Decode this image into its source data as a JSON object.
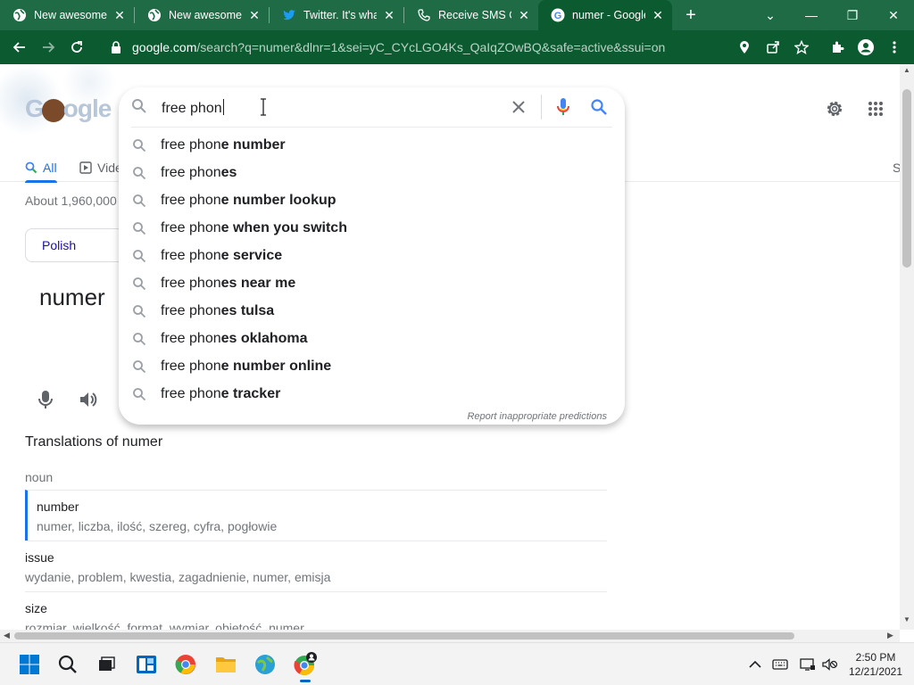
{
  "browser": {
    "tabs": [
      {
        "title": "New awesome t",
        "icon": "globe-icon",
        "active": false
      },
      {
        "title": "New awesome t",
        "icon": "globe-icon",
        "active": false
      },
      {
        "title": "Twitter. It's what",
        "icon": "twitter-icon",
        "active": false
      },
      {
        "title": "Receive SMS Or",
        "icon": "phone-icon",
        "active": false
      },
      {
        "title": "numer - Google",
        "icon": "google-icon",
        "active": true
      }
    ],
    "url_host": "google.com",
    "url_path": "/search?q=numer&dlnr=1&sei=yC_CYcLGO4Ks_QaIqZOwBQ&safe=active&ssui=on",
    "colors": {
      "chrome_dark": "#0b5a30",
      "tabstrip": "#1e6b45"
    }
  },
  "search": {
    "query": "free phon",
    "suggestions": [
      {
        "prefix": "free phon",
        "completion": "e number"
      },
      {
        "prefix": "free phon",
        "completion": "es"
      },
      {
        "prefix": "free phon",
        "completion": "e number lookup"
      },
      {
        "prefix": "free phon",
        "completion": "e when you switch"
      },
      {
        "prefix": "free phon",
        "completion": "e service"
      },
      {
        "prefix": "free phon",
        "completion": "es near me"
      },
      {
        "prefix": "free phon",
        "completion": "es tulsa"
      },
      {
        "prefix": "free phon",
        "completion": "es oklahoma"
      },
      {
        "prefix": "free phon",
        "completion": "e number online"
      },
      {
        "prefix": "free phon",
        "completion": "e tracker"
      }
    ],
    "report_link": "Report inappropriate predictions"
  },
  "results": {
    "tabs": [
      {
        "label": "All",
        "selected": true
      },
      {
        "label": "Vide",
        "selected": false
      },
      {
        "label": "S",
        "selected": false
      }
    ],
    "stats": "About 1,960,000",
    "language": "Polish",
    "word": "numer",
    "translations_title": "Translations of numer",
    "part_of_speech": "noun",
    "translations": [
      {
        "word": "number",
        "synonyms": "numer, liczba, ilość, szereg, cyfra, pogłowie"
      },
      {
        "word": "issue",
        "synonyms": "wydanie, problem, kwestia, zagadnienie, numer, emisja"
      },
      {
        "word": "size",
        "synonyms": "rozmiar, wielkość, format, wymiar, objętość, numer"
      }
    ]
  },
  "taskbar": {
    "time": "2:50 PM",
    "date": "12/21/2021"
  }
}
